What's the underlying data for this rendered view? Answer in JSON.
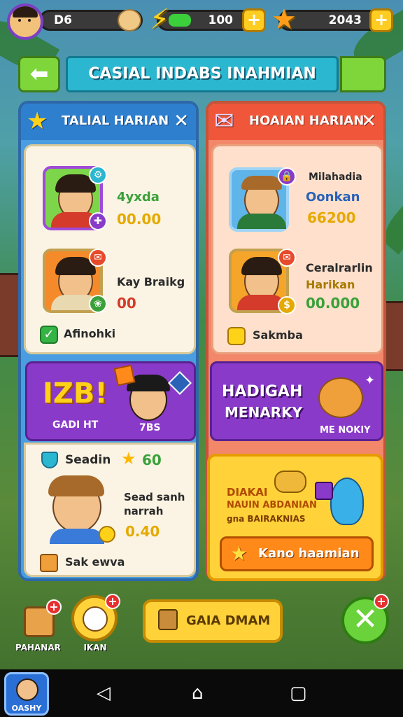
{
  "topbar": {
    "player_name": "D6",
    "energy_value": "100",
    "gold_value": "2043",
    "plus": "+"
  },
  "header": {
    "back_icon": "arrow-left-icon",
    "title": "CASIAL INDABS INAHMIAN"
  },
  "left_panel": {
    "title": "TALIAL HARIAN",
    "close": "✕",
    "rows": [
      {
        "name": "4yxda",
        "value": "00.00"
      },
      {
        "name": "Kay Braikg",
        "value": "00"
      }
    ],
    "footer_label": "Afinohki",
    "promo": {
      "big": "IZB!",
      "sub": "GADI HT",
      "tag": "7BS"
    },
    "reward_row": {
      "label": "Seadin",
      "value": "60"
    },
    "mission": {
      "line1": "Sead sanh",
      "line2": "narrah",
      "value": "0.40"
    },
    "footer2_label": "Sak ewva"
  },
  "right_panel": {
    "title": "HOAIAN HARIAN",
    "close": "✕",
    "rows": [
      {
        "line1": "Milahadia",
        "line2": "Oonkan",
        "value": "66200"
      },
      {
        "line1": "Ceralrarlin",
        "line2": "Harikan",
        "value": "00.000"
      }
    ],
    "footer_label": "Sakmba",
    "promo": {
      "line1": "HADIGAH",
      "line2": "MENARKY",
      "tag": "ME NOKIY"
    },
    "gold_card": {
      "line1": "DIAKAI",
      "line2": "NAUIN ABDANIAN",
      "line3": "gna BAIRAKNIAS",
      "button": "Kano haamian"
    }
  },
  "bottom": {
    "left_label": "PAHANAR",
    "mid_label": "IKAN",
    "cta": "GAIA DMAM",
    "close": "✕"
  },
  "nav": {
    "app_label": "OASHY"
  },
  "colors": {
    "accent_blue": "#2f7fcf",
    "accent_orange": "#f0573a",
    "green_button": "#6ad23a",
    "gold": "#ffd23a",
    "purple": "#8a3ac9"
  }
}
